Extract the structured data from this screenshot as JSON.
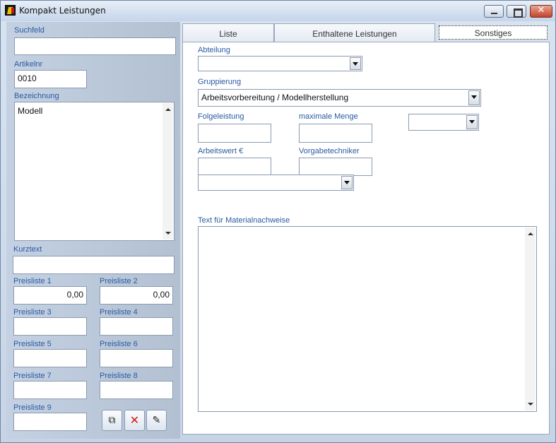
{
  "window": {
    "title": "Kompakt Leistungen"
  },
  "left": {
    "suchfeld_label": "Suchfeld",
    "suchfeld_value": "",
    "artikelnr_label": "Artikelnr",
    "artikelnr_value": "0010",
    "bezeichnung_label": "Bezeichnung",
    "bezeichnung_value": "Modell",
    "kurztext_label": "Kurztext",
    "kurztext_value": "",
    "preislisten": [
      {
        "label": "Preisliste 1",
        "value": "0,00"
      },
      {
        "label": "Preisliste 2",
        "value": "0,00"
      },
      {
        "label": "Preisliste 3",
        "value": ""
      },
      {
        "label": "Preisliste 4",
        "value": ""
      },
      {
        "label": "Preisliste 5",
        "value": ""
      },
      {
        "label": "Preisliste 6",
        "value": ""
      },
      {
        "label": "Preisliste 7",
        "value": ""
      },
      {
        "label": "Preisliste 8",
        "value": ""
      },
      {
        "label": "Preisliste 9",
        "value": ""
      }
    ],
    "buttons": {
      "copy_icon": "copy-icon",
      "delete_icon": "delete-icon",
      "edit_icon": "edit-icon"
    }
  },
  "tabs": [
    {
      "label": "Liste"
    },
    {
      "label": "Enthaltene Leistungen"
    },
    {
      "label": "Sonstiges",
      "active": true
    }
  ],
  "sonstiges": {
    "abteilung_label": "Abteilung",
    "abteilung_value": "",
    "gruppierung_label": "Gruppierung",
    "gruppierung_value": "Arbeitsvorbereitung / Modellherstellung",
    "folgeleistung_label": "Folgeleistung",
    "folgeleistung_value": "",
    "maximale_menge_label": "maximale Menge",
    "maximale_menge_value": "",
    "menge_combo_value": "",
    "arbeitswert_label": "Arbeitswert €",
    "arbeitswert_value": "",
    "vorgabetechniker_label": "Vorgabetechniker",
    "vorgabetechniker_value": "",
    "techniker_combo_value": "",
    "materialnachweise_label": "Text für Materialnachweise",
    "materialnachweise_value": ""
  },
  "colors": {
    "label": "#2a5aa3",
    "close_button": "#c4432b"
  }
}
